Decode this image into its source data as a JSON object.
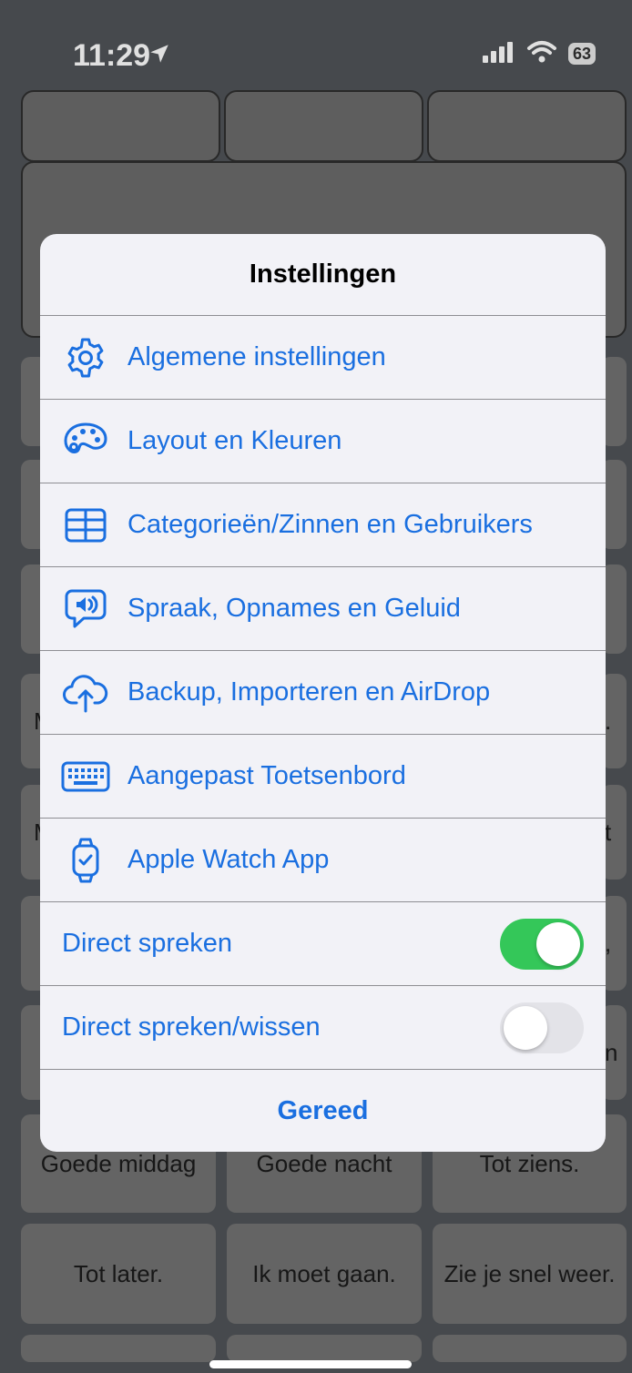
{
  "status": {
    "time": "11:29",
    "battery": "63"
  },
  "background": {
    "row_a": [
      "Goede middag",
      "Goede nacht",
      "Tot ziens."
    ],
    "row_b": [
      "Tot later.",
      "Ik moet gaan.",
      "Zie je snel weer."
    ],
    "left_fragments": [
      "M",
      "M"
    ],
    "right_fragments": [
      ".",
      "t",
      ",",
      "n"
    ]
  },
  "dialog": {
    "title": "Instellingen",
    "items": [
      {
        "label": "Algemene instellingen",
        "icon": "gear-icon"
      },
      {
        "label": "Layout en Kleuren",
        "icon": "palette-icon"
      },
      {
        "label": "Categorieën/Zinnen en Gebruikers",
        "icon": "table-icon"
      },
      {
        "label": "Spraak, Opnames en Geluid",
        "icon": "speaker-bubble-icon"
      },
      {
        "label": "Backup, Importeren en AirDrop",
        "icon": "cloud-upload-icon"
      },
      {
        "label": "Aangepast Toetsenbord",
        "icon": "keyboard-icon"
      },
      {
        "label": "Apple Watch App",
        "icon": "watch-icon"
      }
    ],
    "toggles": [
      {
        "label": "Direct spreken",
        "on": true
      },
      {
        "label": "Direct spreken/wissen",
        "on": false
      }
    ],
    "done": "Gereed"
  },
  "colors": {
    "accent": "#1a6fe0",
    "toggle_on": "#34c759"
  }
}
